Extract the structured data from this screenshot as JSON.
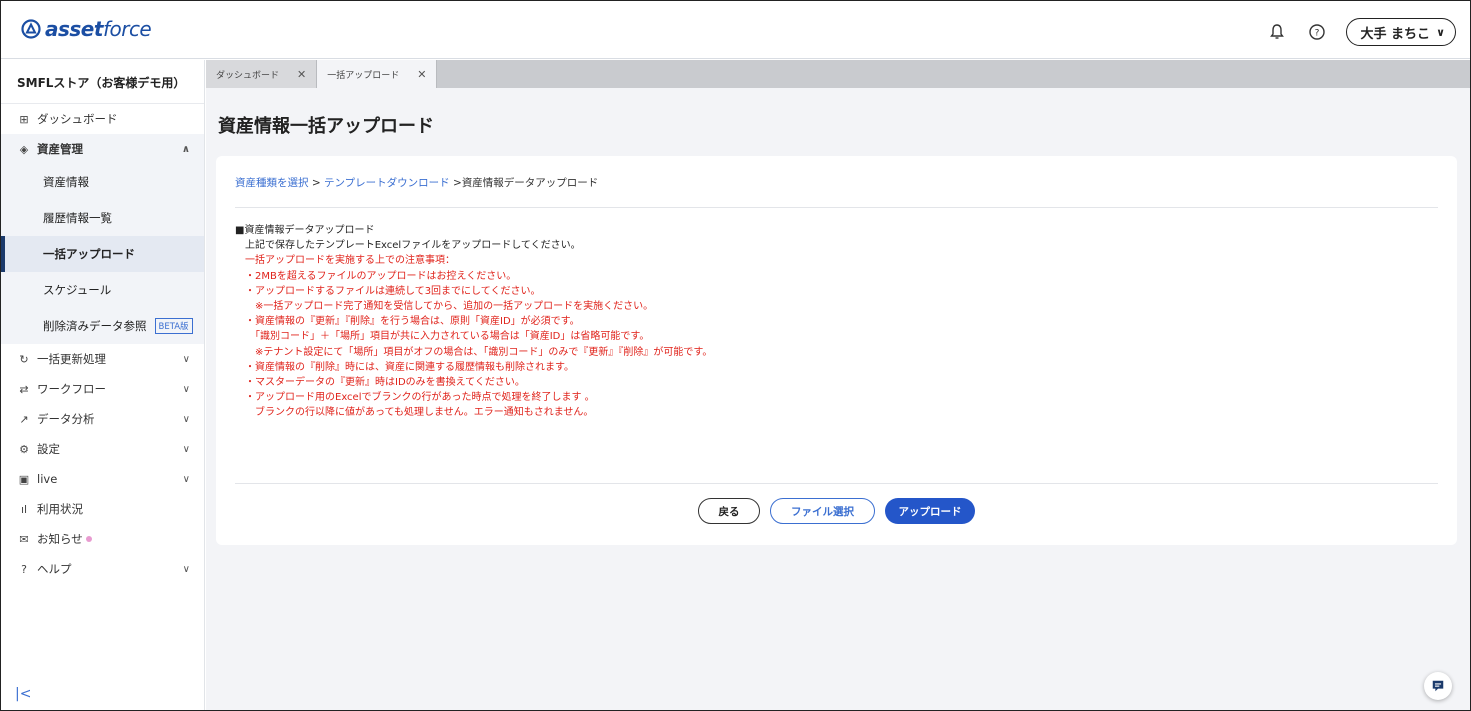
{
  "header": {
    "logo_bold": "asset",
    "logo_light": "force",
    "user_name": "大手 まちこ",
    "icons": [
      "bell-icon",
      "help-circle-icon",
      "chevron-down-icon"
    ]
  },
  "sidebar": {
    "store_name": "SMFLストア（お客様デモ用）",
    "dashboard": "ダッシュボード",
    "asset_mgmt": "資産管理",
    "sub_items": {
      "asset_info": "資産情報",
      "history": "履歴情報一覧",
      "bulk_upload": "一括アップロード",
      "schedule": "スケジュール",
      "deleted": "削除済みデータ参照",
      "beta": "BETA版"
    },
    "bulk_update": "一括更新処理",
    "workflow": "ワークフロー",
    "analytics": "データ分析",
    "settings": "設定",
    "live": "live",
    "usage": "利用状況",
    "news": "お知らせ",
    "help": "ヘルプ"
  },
  "tabs": [
    {
      "label": "ダッシュボード"
    },
    {
      "label": "一括アップロード"
    }
  ],
  "page": {
    "title": "資産情報一括アップロード",
    "breadcrumb": {
      "step1": "資産種類を選択",
      "sep1": " > ",
      "step2": "テンプレートダウンロード",
      "sep2": " >",
      "step3": "資産情報データアップロード"
    },
    "notes": {
      "heading": "■資産情報データアップロード",
      "intro": "　上記で保存したテンプレートExcelファイルをアップロードしてください。",
      "caution_title": "　一括アップロードを実施する上での注意事項：",
      "l1": "　・2MBを超えるファイルのアップロードはお控えください。",
      "l2": "　・アップロードするファイルは連続して3回までにしてください。",
      "l3": "　　※一括アップロード完了通知を受信してから、追加の一括アップロードを実施ください。",
      "l4": "　・資産情報の『更新』『削除』を行う場合は、原則「資産ID」が必須です。",
      "l5": "　　「識別コード」＋「場所」項目が共に入力されている場合は「資産ID」は省略可能です。",
      "l6": "　　※テナント設定にて「場所」項目がオフの場合は、「識別コード」のみで『更新』『削除』が可能です。",
      "l7": "　・資産情報の『削除』時には、資産に関連する履歴情報も削除されます。",
      "l8": "　・マスターデータの『更新』時はIDのみを書換えてください。",
      "l9": "　・アップロード用のExcelでブランクの行があった時点で処理を終了します 。",
      "l10": "　　ブランクの行以降に値があっても処理しません。エラー通知もされません。"
    },
    "buttons": {
      "back": "戻る",
      "file_select": "ファイル選択",
      "upload": "アップロード"
    }
  },
  "colors": {
    "brand": "#1b4ea3",
    "accent": "#2456c9",
    "link": "#3b6fd1",
    "warning": "#e0231b"
  }
}
